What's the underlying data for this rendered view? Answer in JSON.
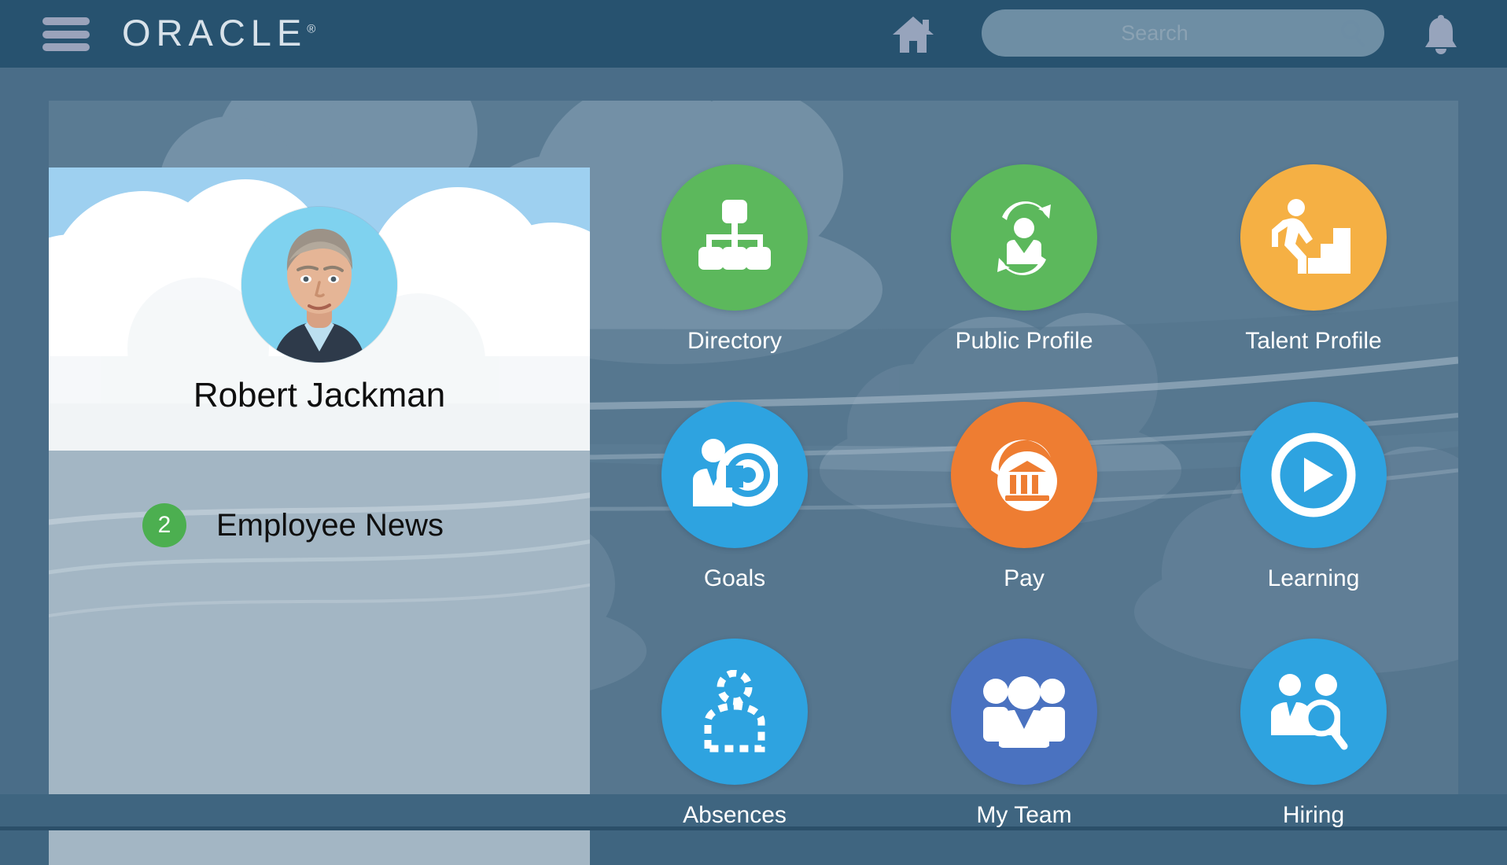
{
  "header": {
    "menu_icon": "hamburger-menu-icon",
    "brand": "ORACLE",
    "brand_mark": "®",
    "home_icon": "home-icon",
    "bell_icon": "notification-bell-icon",
    "search": {
      "placeholder": "Search",
      "value": "",
      "icon": "search-magnifier-icon"
    }
  },
  "profile": {
    "name": "Robert Jackman",
    "avatar_icon": "user-avatar-photo"
  },
  "news": {
    "count": "2",
    "label": "Employee News"
  },
  "colors": {
    "nav_bar": "#27526f",
    "page_bg": "#4a6d88",
    "panel_bg": "#5a7b93",
    "news_panel": "#a3b6c4",
    "green": "#5cb85c",
    "orange_amber": "#f5b044",
    "orange": "#ee7d32",
    "blue": "#2ea3e0",
    "indigo": "#4a72c0",
    "badge_green": "#4caf50"
  },
  "apps": [
    {
      "label": "Directory",
      "icon": "org-chart-icon",
      "color": "#5cb85c"
    },
    {
      "label": "Public Profile",
      "icon": "person-refresh-icon",
      "color": "#5cb85c"
    },
    {
      "label": "Talent Profile",
      "icon": "person-stairs-icon",
      "color": "#f5b044"
    },
    {
      "label": "Goals",
      "icon": "person-target-icon",
      "color": "#2ea3e0"
    },
    {
      "label": "Pay",
      "icon": "bank-building-icon",
      "color": "#ee7d32"
    },
    {
      "label": "Learning",
      "icon": "play-circle-icon",
      "color": "#2ea3e0"
    },
    {
      "label": "Absences",
      "icon": "dashed-person-icon",
      "color": "#2ea3e0"
    },
    {
      "label": "My Team",
      "icon": "people-group-icon",
      "color": "#4a72c0"
    },
    {
      "label": "Hiring",
      "icon": "person-search-icon",
      "color": "#2ea3e0"
    }
  ]
}
